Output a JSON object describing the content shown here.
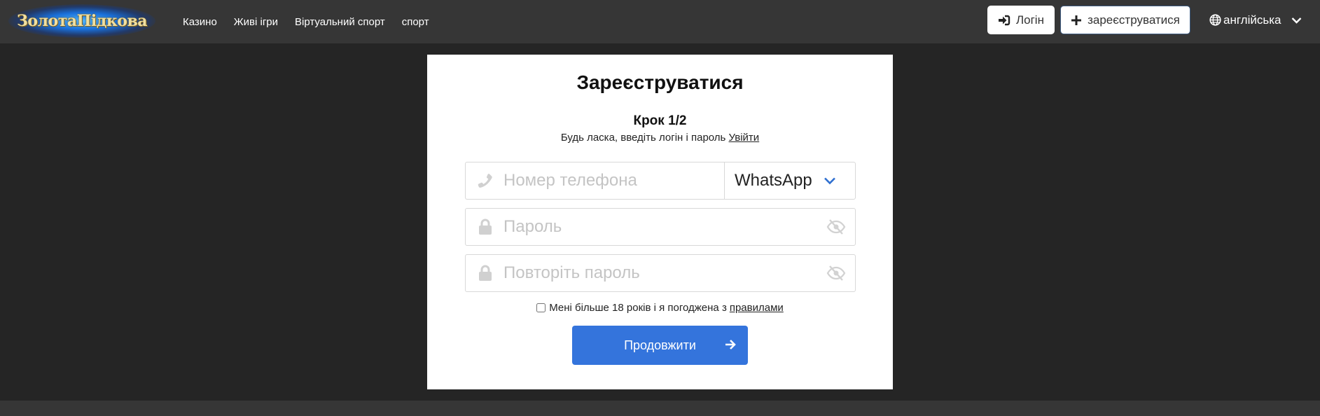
{
  "header": {
    "logo_text": "ЗолотаПідкова",
    "nav": [
      {
        "label": "Казино"
      },
      {
        "label": "Живі ігри"
      },
      {
        "label": "Віртуальний спорт"
      },
      {
        "label": "спорт"
      }
    ],
    "login_label": "Логін",
    "register_label": "зареєструватися",
    "language_label": "англійська"
  },
  "form": {
    "title": "Зареєструватися",
    "step": "Крок 1/2",
    "subtitle": "Будь ласка, введіть логін і пароль",
    "login_link": "Увійти",
    "phone_placeholder": "Номер телефона",
    "phone_value": "",
    "messenger_selected": "WhatsApp",
    "password_placeholder": "Пароль",
    "password_value": "",
    "repeat_password_placeholder": "Повторіть пароль",
    "repeat_password_value": "",
    "agree_text": "Мені більше 18 років і я погоджена з",
    "rules_link": "правилами",
    "agree_checked": false,
    "continue_label": "Продовжити"
  },
  "colors": {
    "nav_bg": "#363636",
    "page_bg": "#252525",
    "primary": "#3474dc",
    "card_bg": "#ffffff"
  }
}
